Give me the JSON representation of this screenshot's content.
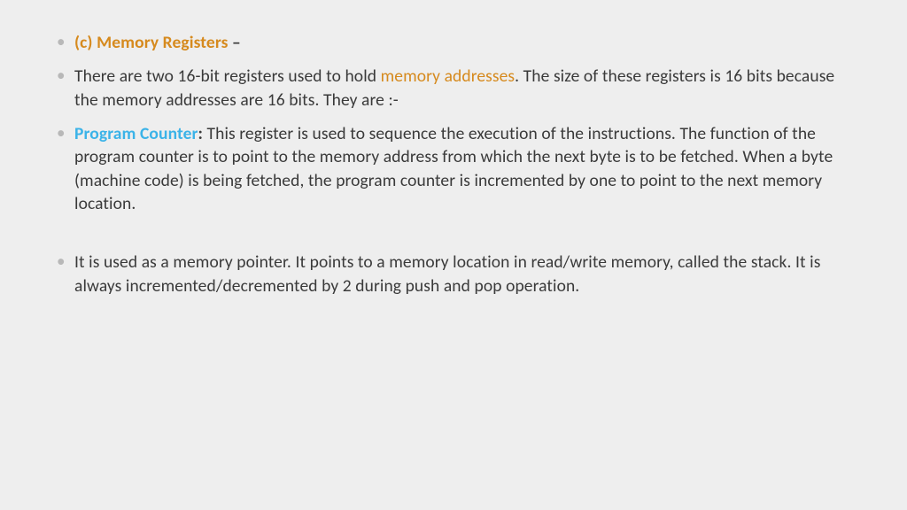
{
  "bullets": {
    "b1": {
      "heading": "(c) Memory Registers ",
      "dash": "–"
    },
    "b2": {
      "pre": "There are two 16-bit registers used to hold ",
      "link": "memory addresses",
      "post": ". The size of these registers is 16 bits because the memory addresses are 16 bits. They are :-"
    },
    "b3": {
      "heading": "Program Counter",
      "colon": ": ",
      "body": "This register is used to sequence the execution of the instructions. The function of the program counter is to point to the memory address from which the next byte is to be fetched. When a byte (machine code) is being fetched, the program counter is incremented by one to point to the next memory location."
    },
    "b4": {
      "body": " It is used as a memory pointer. It points to a memory location in read/write memory, called the stack. It is always incremented/decremented by 2 during push and pop operation."
    }
  }
}
